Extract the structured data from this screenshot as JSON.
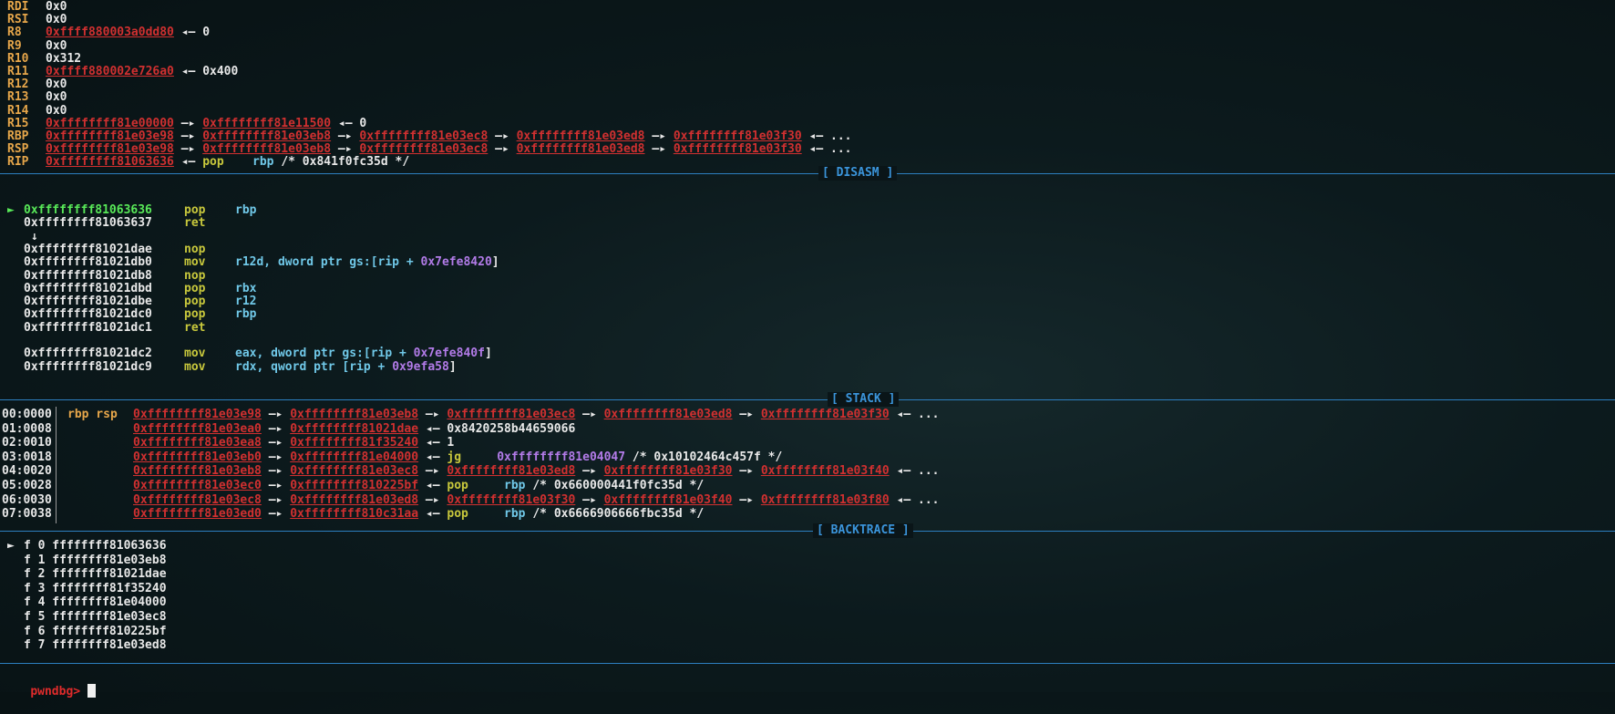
{
  "registers": [
    {
      "name": "RDI",
      "text": "0x0"
    },
    {
      "name": "RSI",
      "text": "0x0"
    },
    {
      "name": "R8",
      "a1": "0xffff880003a0dd80",
      "tail": " ◂— 0"
    },
    {
      "name": "R9",
      "text": "0x0"
    },
    {
      "name": "R10",
      "text": "0x312"
    },
    {
      "name": "R11",
      "a1": "0xffff880002e726a0",
      "tail": " ◂— 0x400"
    },
    {
      "name": "R12",
      "text": "0x0"
    },
    {
      "name": "R13",
      "text": "0x0"
    },
    {
      "name": "R14",
      "text": "0x0"
    },
    {
      "name": "R15",
      "a1": "0xffffffff81e00000",
      "a2": "0xffffffff81e11500",
      "tail": " ◂— 0"
    },
    {
      "name": "RBP",
      "a1": "0xffffffff81e03e98",
      "a2": "0xffffffff81e03eb8",
      "a3": "0xffffffff81e03ec8",
      "a4": "0xffffffff81e03ed8",
      "a5": "0xffffffff81e03f30",
      "tail": " ◂— ..."
    },
    {
      "name": "RSP",
      "a1": "0xffffffff81e03e98",
      "a2": "0xffffffff81e03eb8",
      "a3": "0xffffffff81e03ec8",
      "a4": "0xffffffff81e03ed8",
      "a5": "0xffffffff81e03f30",
      "tail": " ◂— ..."
    },
    {
      "name": "RIP",
      "a1": "0xffffffff81063636",
      "mn": "pop",
      "op": "rbp",
      "cmt": "/* 0x841f0fc35d */"
    }
  ],
  "sections": {
    "disasm": "[ DISASM ]",
    "stack": "[ STACK ]",
    "backtrace": "[ BACKTRACE ]"
  },
  "disasm": [
    {
      "marker": "►",
      "addr": "0xffffffff81063636",
      "mn": "pop",
      "op": "rbp",
      "current": true
    },
    {
      "addr": "0xffffffff81063637",
      "mn": "ret",
      "op": ""
    },
    {
      "addr": "↓",
      "mn": "",
      "op": ""
    },
    {
      "addr": "0xffffffff81021dae",
      "mn": "nop",
      "op": ""
    },
    {
      "addr": "0xffffffff81021db0",
      "mn": "mov",
      "op": "r12d, dword ptr gs:[rip + ",
      "num": "0x7efe8420",
      "end": "]"
    },
    {
      "addr": "0xffffffff81021db8",
      "mn": "nop",
      "op": ""
    },
    {
      "addr": "0xffffffff81021dbd",
      "mn": "pop",
      "op": "rbx"
    },
    {
      "addr": "0xffffffff81021dbe",
      "mn": "pop",
      "op": "r12"
    },
    {
      "addr": "0xffffffff81021dc0",
      "mn": "pop",
      "op": "rbp"
    },
    {
      "addr": "0xffffffff81021dc1",
      "mn": "ret",
      "op": ""
    },
    {
      "addr": "",
      "mn": "",
      "op": ""
    },
    {
      "addr": "0xffffffff81021dc2",
      "mn": "mov",
      "op": "eax, dword ptr gs:[rip + ",
      "num": "0x7efe840f",
      "end": "]"
    },
    {
      "addr": "0xffffffff81021dc9",
      "mn": "mov",
      "op": "rdx, qword ptr [rip + ",
      "num": "0x9efa58",
      "end": "]"
    }
  ],
  "stack": [
    {
      "off": "00:0000",
      "regs": "rbp rsp",
      "a1": "0xffffffff81e03e98",
      "a2": "0xffffffff81e03eb8",
      "a3": "0xffffffff81e03ec8",
      "a4": "0xffffffff81e03ed8",
      "a5": "0xffffffff81e03f30",
      "tail": " ◂— ..."
    },
    {
      "off": "01:0008",
      "a1": "0xffffffff81e03ea0",
      "a2": "0xffffffff81021dae",
      "tail": " ◂— 0x8420258b44659066"
    },
    {
      "off": "02:0010",
      "a1": "0xffffffff81e03ea8",
      "a2": "0xffffffff81f35240",
      "tail": " ◂— 1"
    },
    {
      "off": "03:0018",
      "a1": "0xffffffff81e03eb0",
      "a2": "0xffffffff81e04000",
      "mn": "jg",
      "op2": "0xffffffff81e04047",
      "cmt": " /* 0x10102464c457f */"
    },
    {
      "off": "04:0020",
      "a1": "0xffffffff81e03eb8",
      "a2": "0xffffffff81e03ec8",
      "a3": "0xffffffff81e03ed8",
      "a4": "0xffffffff81e03f30",
      "a5": "0xffffffff81e03f40",
      "tail": " ◂— ..."
    },
    {
      "off": "05:0028",
      "a1": "0xffffffff81e03ec0",
      "a2": "0xffffffff810225bf",
      "mn": "pop",
      "op": "rbp",
      "cmt": " /* 0x660000441f0fc35d */"
    },
    {
      "off": "06:0030",
      "a1": "0xffffffff81e03ec8",
      "a2": "0xffffffff81e03ed8",
      "a3": "0xffffffff81e03f30",
      "a4": "0xffffffff81e03f40",
      "a5": "0xffffffff81e03f80",
      "tail": " ◂— ..."
    },
    {
      "off": "07:0038",
      "a1": "0xffffffff81e03ed0",
      "a2": "0xffffffff810c31aa",
      "mn": "pop",
      "op": "rbp",
      "cmt": " /* 0x6666906666fbc35d */"
    }
  ],
  "backtrace": [
    {
      "marker": "►",
      "frame": "f 0 ffffffff81063636"
    },
    {
      "frame": "f 1 ffffffff81e03eb8"
    },
    {
      "frame": "f 2 ffffffff81021dae"
    },
    {
      "frame": "f 3 ffffffff81f35240"
    },
    {
      "frame": "f 4 ffffffff81e04000"
    },
    {
      "frame": "f 5 ffffffff81e03ec8"
    },
    {
      "frame": "f 6 ffffffff810225bf"
    },
    {
      "frame": "f 7 ffffffff81e03ed8"
    }
  ],
  "prompt": "pwndbg>",
  "arrow": " —▸ ",
  "colors": {
    "address": "#d03030",
    "register": "#e6a64a",
    "mnemonic": "#c8c83c",
    "operand": "#70c8e8",
    "number": "#b27be8",
    "current": "#58e858",
    "separator": "#2d7fc0"
  }
}
